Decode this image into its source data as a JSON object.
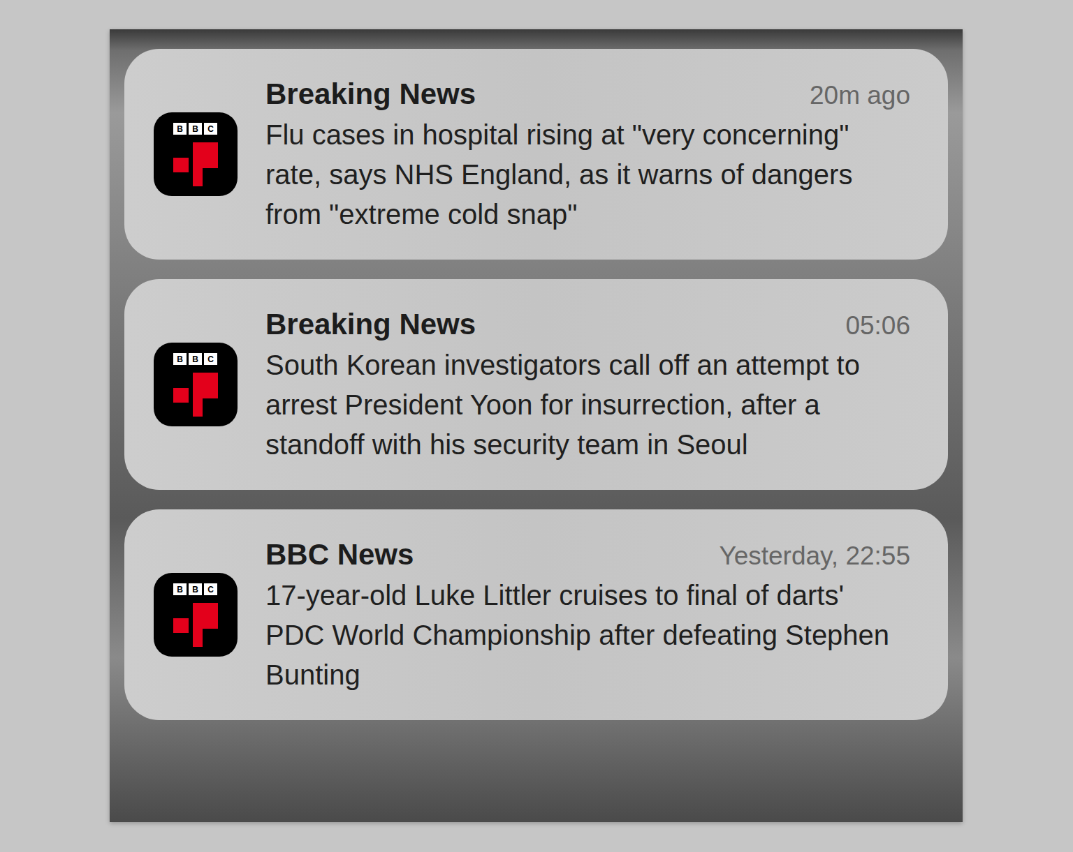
{
  "notifications": [
    {
      "app": "Breaking News",
      "time": "20m ago",
      "body": "Flu cases in hospital rising at \"very concerning\" rate, says NHS England, as it warns of dangers from \"extreme cold snap\"",
      "icon_letters": [
        "B",
        "B",
        "C"
      ]
    },
    {
      "app": "Breaking News",
      "time": "05:06",
      "body": "South Korean investigators call off an attempt to arrest President Yoon for insurrection, after a standoff with his security team in Seoul",
      "icon_letters": [
        "B",
        "B",
        "C"
      ]
    },
    {
      "app": "BBC News",
      "time": "Yesterday, 22:55",
      "body": "17-year-old Luke Littler cruises to final of darts' PDC World Championship after defeating Stephen Bunting",
      "icon_letters": [
        "B",
        "B",
        "C"
      ]
    }
  ]
}
